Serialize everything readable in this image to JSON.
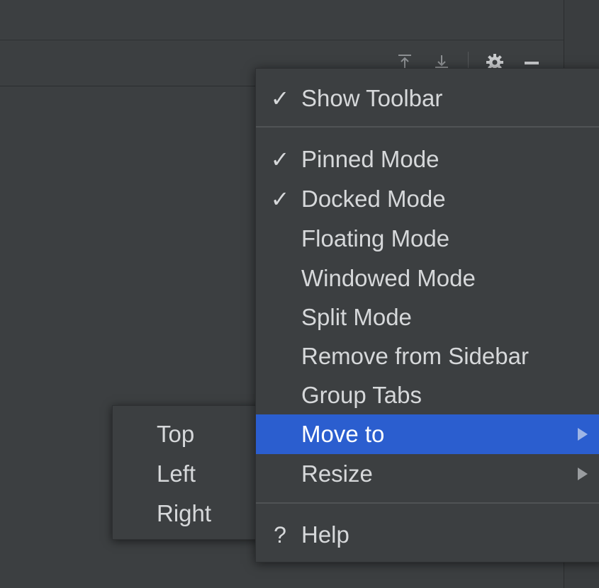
{
  "header": {
    "tools": [
      {
        "name": "scroll-to-top-icon",
        "glyph": "⤒"
      },
      {
        "name": "scroll-to-bottom-icon",
        "glyph": "⤓"
      },
      {
        "name": "gear-icon",
        "glyph": "⚙"
      },
      {
        "name": "minimize-icon",
        "glyph": "—"
      }
    ]
  },
  "menu": {
    "items": [
      {
        "label": "Show Toolbar",
        "check": "✓"
      },
      {
        "label": "Pinned Mode",
        "check": "✓"
      },
      {
        "label": "Docked Mode",
        "check": "✓"
      },
      {
        "label": "Floating Mode",
        "check": ""
      },
      {
        "label": "Windowed Mode",
        "check": ""
      },
      {
        "label": "Split Mode",
        "check": ""
      },
      {
        "label": "Remove from Sidebar",
        "check": ""
      },
      {
        "label": "Group Tabs",
        "check": ""
      },
      {
        "label": "Move to",
        "check": "",
        "submenu": true,
        "active": true
      },
      {
        "label": "Resize",
        "check": "",
        "submenu": true
      },
      {
        "label": "Help",
        "check": "?"
      }
    ]
  },
  "submenu": {
    "items": [
      {
        "label": "Top"
      },
      {
        "label": "Left"
      },
      {
        "label": "Right"
      }
    ]
  },
  "colors": {
    "background": "#3c3f41",
    "selection": "#2b5ecf",
    "text": "#d6d8da",
    "separator": "#505355"
  }
}
